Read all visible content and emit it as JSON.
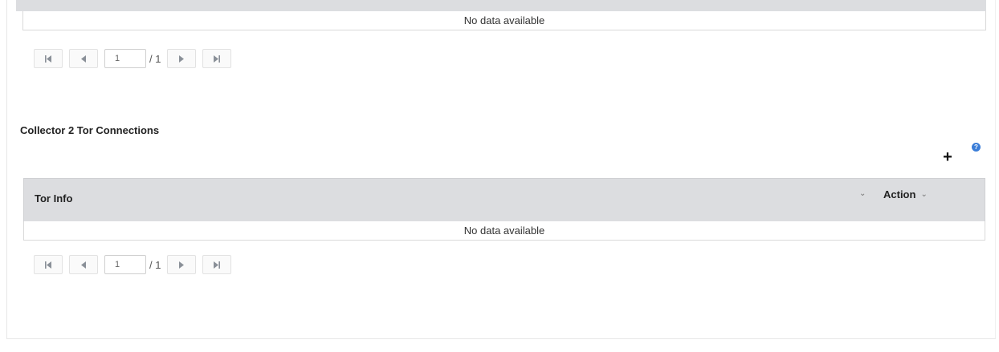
{
  "top_table": {
    "empty_message": "No data available",
    "pager": {
      "current_page": "1",
      "total_label": "/ 1"
    }
  },
  "tor_section": {
    "title": "Collector 2 Tor Connections",
    "add_label": "+",
    "help_label": "?",
    "table": {
      "columns": [
        {
          "label": "Tor Info"
        },
        {
          "label": "Action"
        }
      ],
      "sort_glyph": "⌄",
      "empty_message": "No data available"
    },
    "pager": {
      "current_page": "1",
      "total_label": "/ 1"
    }
  }
}
